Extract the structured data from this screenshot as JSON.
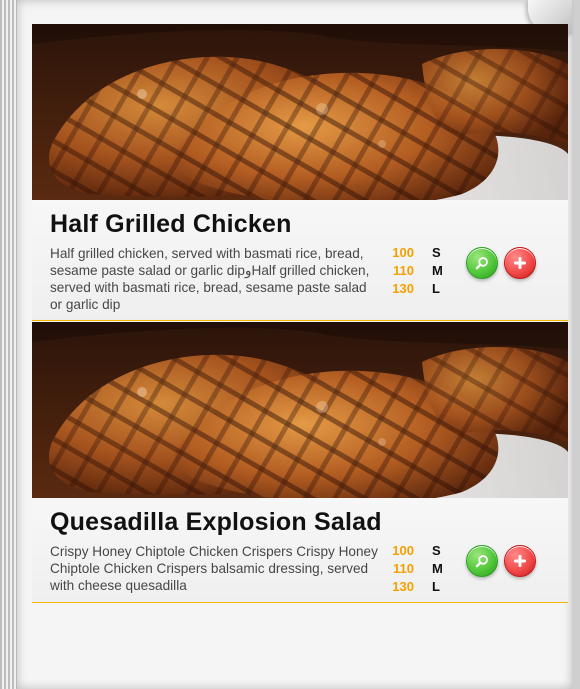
{
  "menu": {
    "items": [
      {
        "title": "Half Grilled Chicken",
        "description": "Half grilled chicken, served with basmati rice, bread, sesame paste salad or garlic dipوHalf grilled chicken, served with basmati rice, bread, sesame paste salad or garlic dip",
        "prices": [
          {
            "price": "100",
            "size": "S"
          },
          {
            "price": "110",
            "size": "M"
          },
          {
            "price": "130",
            "size": "L"
          }
        ],
        "icons": {
          "zoom": "zoom-icon",
          "add": "plus-icon"
        }
      },
      {
        "title": "Quesadilla Explosion Salad",
        "description": "Crispy Honey Chiptole Chicken Crispers Crispy Honey Chiptole Chicken Crispers balsamic dressing, served with cheese quesadilla",
        "prices": [
          {
            "price": "100",
            "size": "S"
          },
          {
            "price": "110",
            "size": "M"
          },
          {
            "price": "130",
            "size": "L"
          }
        ],
        "icons": {
          "zoom": "zoom-icon",
          "add": "plus-icon"
        }
      }
    ]
  },
  "colors": {
    "price": "#f5a000",
    "divider": "#f5b400",
    "zoom_button": "#52c83a",
    "add_button": "#f24a4a"
  }
}
